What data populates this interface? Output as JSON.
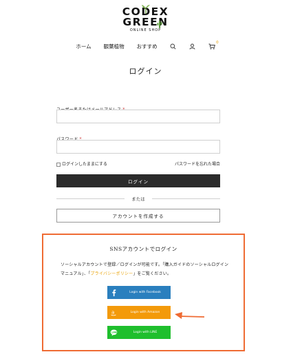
{
  "brand": {
    "line1": "CODEX",
    "line2": "GREEN",
    "tagline": "ONLINE SHOP"
  },
  "nav": {
    "items": [
      "ホーム",
      "観葉植物",
      "おすすめ"
    ],
    "cart_count": "0"
  },
  "page_title": "ログイン",
  "form": {
    "username_label": "ユーザー名またはメールアドレス",
    "password_label": "パスワード",
    "required_mark": "*",
    "remember_label": "ログインしたままにする",
    "forgot_link": "パスワードを忘れた場合",
    "login_button": "ログイン",
    "or_text": "または",
    "create_account_button": "アカウントを作成する"
  },
  "sns": {
    "title": "SNSアカウントでログイン",
    "text_part1": "ソーシャルアカウントで登録／ログインが可能です。「購入ガイドのソーシャルログインマニュアル」、「",
    "privacy_link": "プライバシーポリシー",
    "text_part2": "」をご覧ください。",
    "facebook_label": "Login with Facebook",
    "amazon_label": "Login with Amazon",
    "line_label": "Login with LINE"
  },
  "colors": {
    "accent": "#ef6b33",
    "facebook": "#2a7fbe",
    "amazon": "#f39a0a",
    "line": "#1fbf2d",
    "cart": "#e8a000"
  }
}
